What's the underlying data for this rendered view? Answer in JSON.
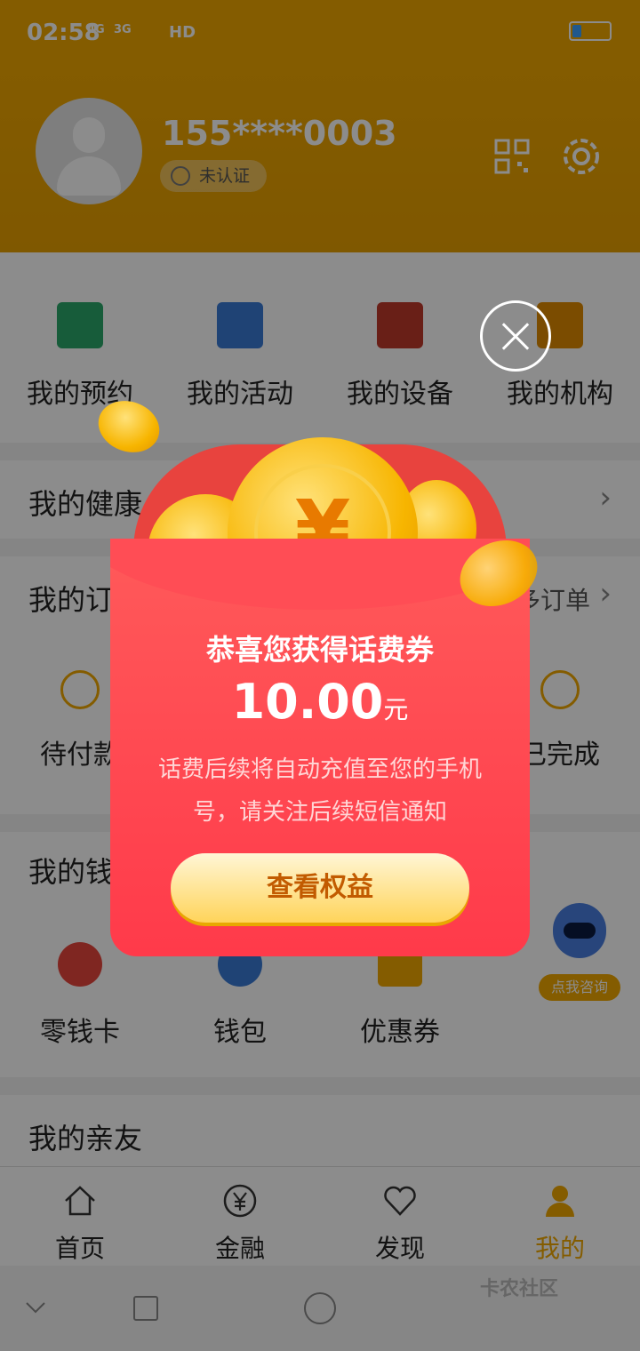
{
  "status_bar": {
    "time": "02:58",
    "network1": "4G",
    "network2": "3G",
    "hd": "HD"
  },
  "profile": {
    "phone": "155****0003",
    "cert_status": "未认证"
  },
  "shortcuts": [
    {
      "label": "我的预约",
      "color": "#2aa86b"
    },
    {
      "label": "我的活动",
      "color": "#3a7bd5"
    },
    {
      "label": "我的设备",
      "color": "#c0392b"
    },
    {
      "label": "我的机构",
      "color": "#e08a00"
    }
  ],
  "sections": {
    "health": {
      "title": "我的健康"
    },
    "orders": {
      "title": "我的订单",
      "more": "更多订单",
      "items": [
        "待付款",
        "已完成"
      ]
    },
    "wallet": {
      "title": "我的钱包",
      "items": [
        "零钱卡",
        "钱包",
        "优惠券"
      ]
    },
    "family": {
      "title": "我的亲友"
    }
  },
  "assistant": {
    "label": "点我咨询"
  },
  "tabs": [
    {
      "label": "首页",
      "icon": "home-icon",
      "active": false
    },
    {
      "label": "金融",
      "icon": "yuan-icon",
      "active": false
    },
    {
      "label": "发现",
      "icon": "heart-icon",
      "active": false
    },
    {
      "label": "我的",
      "icon": "person-icon",
      "active": true
    }
  ],
  "popup": {
    "title": "恭喜您获得话费券",
    "amount": "10.00",
    "unit": "元",
    "description": "话费后续将自动充值至您的手机号，请关注后续短信通知",
    "button": "查看权益",
    "coin_symbol": "¥"
  },
  "watermark": "卡农社区"
}
